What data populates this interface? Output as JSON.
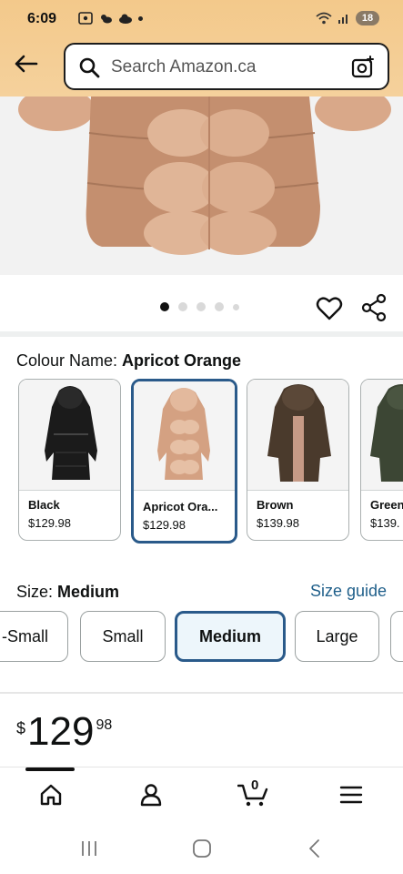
{
  "status_bar": {
    "time": "6:09",
    "battery": "18"
  },
  "search": {
    "placeholder": "Search Amazon.ca"
  },
  "gallery": {
    "dots_total": 5,
    "active_index": 0
  },
  "colour": {
    "label": "Colour Name: ",
    "selected_value": "Apricot Orange",
    "options": [
      {
        "name": "Black",
        "price": "$129.98",
        "color": "#1b1b1b"
      },
      {
        "name": "Apricot Ora...",
        "price": "$129.98",
        "color": "#d4a182"
      },
      {
        "name": "Brown",
        "price": "$139.98",
        "color": "#4a3a2c"
      },
      {
        "name": "Green",
        "price": "$139.",
        "color": "#3c4634"
      }
    ]
  },
  "size": {
    "label": "Size: ",
    "selected_value": "Medium",
    "guide_label": "Size guide",
    "options": [
      "-Small",
      "Small",
      "Medium",
      "Large"
    ]
  },
  "price": {
    "currency": "$",
    "whole": "129",
    "fraction": "98"
  },
  "bottom_nav": {
    "cart_count": "0",
    "items": [
      "home-icon",
      "account-icon",
      "cart-icon",
      "menu-icon"
    ]
  },
  "theme": {
    "header_color": "#f3c98b",
    "selected_border": "#2a5a8a",
    "link_color": "#1f5f8a"
  }
}
